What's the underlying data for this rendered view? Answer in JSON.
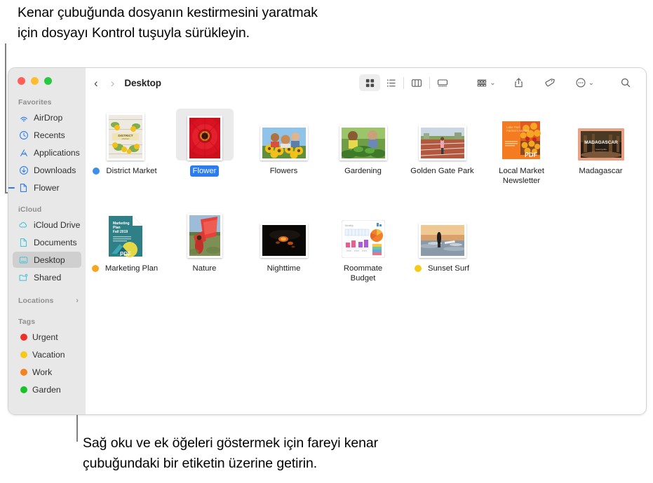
{
  "captions": {
    "top": "Kenar çubuğunda dosyanın kestirmesini yaratmak\niçin dosyayı Kontrol tuşuyla sürükleyin.",
    "bottom": "Sağ oku ve ek öğeleri göstermek için fareyi kenar\nçubuğundaki bir etiketin üzerine getirin."
  },
  "window": {
    "traffic_lights": [
      {
        "name": "close",
        "color": "#ff5f57"
      },
      {
        "name": "minimize",
        "color": "#febc2e"
      },
      {
        "name": "zoom",
        "color": "#28c840"
      }
    ]
  },
  "toolbar": {
    "back_label": "‹",
    "forward_label": "›",
    "title": "Desktop",
    "buttons": [
      {
        "name": "icon-view-icon",
        "label": "Icon View",
        "active": true
      },
      {
        "name": "list-view-icon",
        "label": "List View",
        "active": false
      },
      {
        "name": "column-view-icon",
        "label": "Column View",
        "active": false
      },
      {
        "name": "gallery-view-icon",
        "label": "Gallery View",
        "active": false
      },
      {
        "name": "group-by-icon",
        "label": "Group",
        "active": false
      },
      {
        "name": "share-icon",
        "label": "Share",
        "active": false
      },
      {
        "name": "tag-icon",
        "label": "Tags",
        "active": false
      },
      {
        "name": "more-icon",
        "label": "More",
        "active": false
      },
      {
        "name": "search-icon",
        "label": "Search",
        "active": false
      }
    ]
  },
  "sidebar": {
    "sections": [
      {
        "title": "Favorites",
        "items": [
          {
            "label": "AirDrop",
            "icon": "airdrop-icon",
            "selected": false
          },
          {
            "label": "Recents",
            "icon": "clock-icon",
            "selected": false
          },
          {
            "label": "Applications",
            "icon": "applications-icon",
            "selected": false
          },
          {
            "label": "Downloads",
            "icon": "download-icon",
            "selected": false
          },
          {
            "label": "Flower",
            "icon": "document-icon",
            "selected": false,
            "drop_indicator": true
          }
        ]
      },
      {
        "title": "iCloud",
        "items": [
          {
            "label": "iCloud Drive",
            "icon": "cloud-icon",
            "selected": false
          },
          {
            "label": "Documents",
            "icon": "document-icon",
            "selected": false
          },
          {
            "label": "Desktop",
            "icon": "desktop-icon",
            "selected": true
          },
          {
            "label": "Shared",
            "icon": "shared-folder-icon",
            "selected": false
          }
        ]
      },
      {
        "title": "Locations",
        "has_chevron": true,
        "chevron": "›",
        "items": []
      },
      {
        "title": "Tags",
        "items": [
          {
            "label": "Urgent",
            "icon": "tag-dot",
            "color": "#ef2f2a",
            "selected": false
          },
          {
            "label": "Vacation",
            "icon": "tag-dot",
            "color": "#f7ca18",
            "selected": false
          },
          {
            "label": "Work",
            "icon": "tag-dot",
            "color": "#f58220",
            "selected": false
          },
          {
            "label": "Garden",
            "icon": "tag-dot",
            "color": "#16c428",
            "selected": false
          }
        ]
      }
    ]
  },
  "files": {
    "rows": [
      [
        {
          "name": "District Market",
          "kind": "doc-port",
          "selected": false,
          "tag_color": "#3d8fe8"
        },
        {
          "name": "Flower",
          "kind": "photo-port",
          "selected": true,
          "tag_color": null
        },
        {
          "name": "Flowers",
          "kind": "photo-land",
          "selected": false,
          "tag_color": null
        },
        {
          "name": "Gardening",
          "kind": "photo-land",
          "selected": false,
          "tag_color": null
        },
        {
          "name": "Golden Gate Park",
          "kind": "photo-land",
          "selected": false,
          "tag_color": null
        },
        {
          "name": "Local Market\nNewsletter",
          "kind": "pdf-orange",
          "selected": false,
          "tag_color": null
        },
        {
          "name": "Madagascar",
          "kind": "photo-frame-orange",
          "selected": false,
          "tag_color": null
        }
      ],
      [
        {
          "name": "Marketing Plan",
          "kind": "pdf-teal",
          "selected": false,
          "tag_color": "#f5a623"
        },
        {
          "name": "Nature",
          "kind": "photo-port",
          "selected": false,
          "tag_color": null
        },
        {
          "name": "Nighttime",
          "kind": "photo-land",
          "selected": false,
          "tag_color": null
        },
        {
          "name": "Roommate\nBudget",
          "kind": "spreadsheet",
          "selected": false,
          "tag_color": null
        },
        {
          "name": "Sunset Surf",
          "kind": "photo-land",
          "selected": false,
          "tag_color": "#f7ca18"
        }
      ]
    ]
  },
  "colors": {
    "accent": "#2b7bf3",
    "sidebar_bg": "#e8e8e8",
    "icloud_icon": "#4ec3d9",
    "favorite_icon": "#2b7bf3"
  }
}
